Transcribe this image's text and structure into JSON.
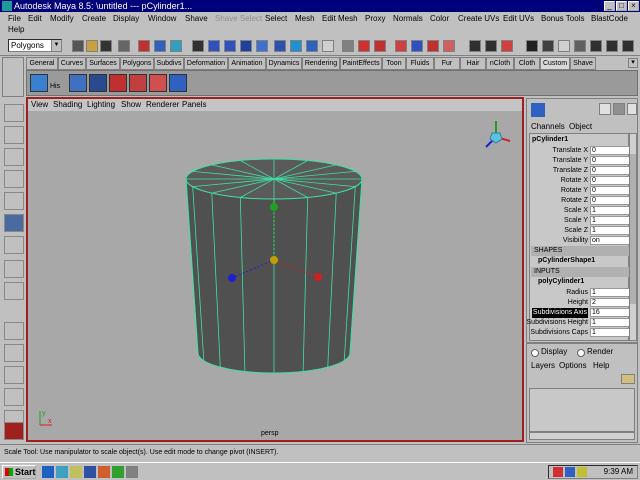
{
  "window": {
    "title": "Autodesk Maya 8.5: \\untitled   ---   pCylinder1...",
    "minimize_glyph": "_",
    "maximize_glyph": "□",
    "close_glyph": "×"
  },
  "menubar": {
    "items": [
      "File",
      "Edit",
      "Modify",
      "Create",
      "Display",
      "Window",
      "Shave",
      "Shave Select",
      "Select",
      "Mesh",
      "Edit Mesh",
      "Proxy",
      "Normals",
      "Color",
      "Create UVs",
      "Edit UVs",
      "Bonus Tools",
      "BlastCode",
      "Help"
    ]
  },
  "statusline": {
    "mode_value": "Polygons",
    "mode_arrow": "▼"
  },
  "shelf_tabs": [
    "General",
    "Curves",
    "Surfaces",
    "Polygons",
    "Subdivs",
    "Deformation",
    "Animation",
    "Dynamics",
    "Rendering",
    "PaintEffects",
    "Toon",
    "Fluids",
    "Fur",
    "Hair",
    "nCloth",
    "Cloth",
    "Custom",
    "Shave"
  ],
  "shelf_active_tab": "Custom",
  "shelf": {
    "icon_label": "His"
  },
  "viewport": {
    "menu": [
      "View",
      "Shading",
      "Lighting",
      "Show",
      "Renderer",
      "Panels"
    ],
    "camera_label": "persp",
    "axis_x": "x",
    "axis_y": "y",
    "gizmo_colors": {
      "x": "#d02020",
      "y": "#20a020",
      "z": "#2020d0",
      "center": "#c0a000"
    },
    "wire_color": "#40e0a0",
    "bg_color": "#a8a8a8"
  },
  "channel_box": {
    "menu": [
      "Channels",
      "Object"
    ],
    "object_name": "pCylinder1",
    "attributes": [
      {
        "name": "Translate X",
        "value": "0"
      },
      {
        "name": "Translate Y",
        "value": "0"
      },
      {
        "name": "Translate Z",
        "value": "0"
      },
      {
        "name": "Rotate X",
        "value": "0"
      },
      {
        "name": "Rotate Y",
        "value": "0"
      },
      {
        "name": "Rotate Z",
        "value": "0"
      },
      {
        "name": "Scale X",
        "value": "1"
      },
      {
        "name": "Scale Y",
        "value": "1"
      },
      {
        "name": "Scale Z",
        "value": "1"
      },
      {
        "name": "Visibility",
        "value": "on"
      }
    ],
    "shapes_header": "SHAPES",
    "shape_name": "pCylinderShape1",
    "inputs_header": "INPUTS",
    "input_name": "polyCylinder1",
    "input_attributes": [
      {
        "name": "Radius",
        "value": "1"
      },
      {
        "name": "Height",
        "value": "2"
      },
      {
        "name": "Subdivisions Axis",
        "value": "16"
      },
      {
        "name": "Subdivisions Height",
        "value": "1"
      },
      {
        "name": "Subdivisions Caps",
        "value": "1"
      }
    ]
  },
  "layer_editor": {
    "display_label": "Display",
    "render_label": "Render",
    "menu": [
      "Layers",
      "Options",
      "Help"
    ]
  },
  "help_line": {
    "text": "Scale Tool: Use manipulator to scale object(s). Use edit mode to change pivot (INSERT)."
  },
  "taskbar": {
    "start_label": "Start",
    "time": "9:39 AM"
  }
}
